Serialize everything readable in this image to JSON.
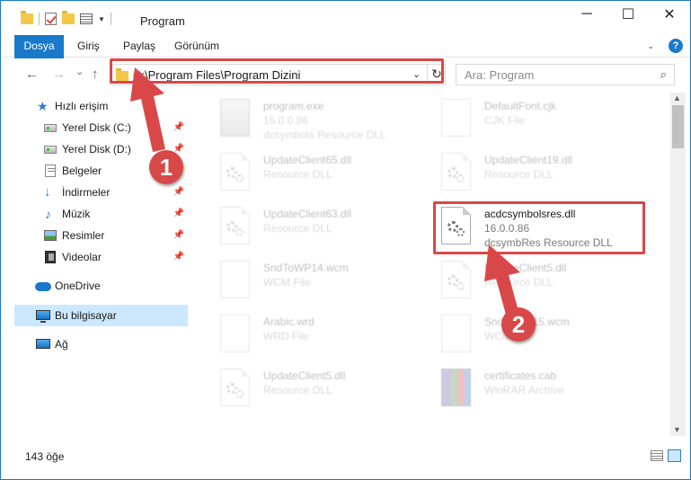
{
  "window": {
    "title": "Program",
    "controls": {
      "minimize": "─",
      "maximize": "☐",
      "close": "✕"
    }
  },
  "ribbon": {
    "tabs": [
      "Dosya",
      "Giriş",
      "Paylaş",
      "Görünüm"
    ],
    "help": "?"
  },
  "nav": {
    "back": "←",
    "forward": "→",
    "recent": "⌄",
    "up": "↑",
    "address": "C:\\Program Files\\Program Dizini",
    "search_placeholder": "Ara: Program"
  },
  "sidebar": {
    "items": [
      {
        "label": "Hızlı erişim",
        "icon": "star-icon",
        "pinned": false
      },
      {
        "label": "Yerel Disk (C:)",
        "icon": "disk-icon",
        "pinned": true
      },
      {
        "label": "Yerel Disk (D:)",
        "icon": "disk-icon",
        "pinned": true
      },
      {
        "label": "Belgeler",
        "icon": "document-icon",
        "pinned": true
      },
      {
        "label": "İndirmeler",
        "icon": "download-icon",
        "pinned": true
      },
      {
        "label": "Müzik",
        "icon": "music-icon",
        "pinned": true
      },
      {
        "label": "Resimler",
        "icon": "pictures-icon",
        "pinned": true
      },
      {
        "label": "Videolar",
        "icon": "videos-icon",
        "pinned": true
      },
      {
        "label": "OneDrive",
        "icon": "cloud-icon",
        "pinned": false
      },
      {
        "label": "Bu bilgisayar",
        "icon": "computer-icon",
        "pinned": false,
        "selected": true
      },
      {
        "label": "Ağ",
        "icon": "network-icon",
        "pinned": false
      }
    ]
  },
  "files": [
    {
      "name": "program.exe",
      "line2": "16.0.0.86",
      "line3": "dcsymbols Resource DLL",
      "icon": "exe-icon",
      "faded": true
    },
    {
      "name": "DefaultFont.cjk",
      "line2": "CJK File",
      "line3": "",
      "icon": "blank-file-icon",
      "faded": true
    },
    {
      "name": "UpdateClient65.dll",
      "line2": "Resource DLL",
      "line3": "",
      "icon": "dll-icon",
      "faded": true
    },
    {
      "name": "UpdateClient19.dll",
      "line2": "Resource DLL",
      "line3": "",
      "icon": "dll-icon",
      "faded": true
    },
    {
      "name": "UpdateClient63.dll",
      "line2": "Resource DLL",
      "line3": "",
      "icon": "dll-icon",
      "faded": true
    },
    {
      "name": "acdcsymbolsres.dll",
      "line2": "16.0.0.86",
      "line3": "dcsymbRes Resource DLL",
      "icon": "dll-icon",
      "faded": false
    },
    {
      "name": "SndToWP14.wcm",
      "line2": "WCM File",
      "line3": "",
      "icon": "blank-file-icon",
      "faded": true
    },
    {
      "name": "UpdateClient5.dll",
      "line2": "Resource DLL",
      "line3": "",
      "icon": "dll-icon",
      "faded": true
    },
    {
      "name": "Arabic.wrd",
      "line2": "WRD File",
      "line3": "",
      "icon": "blank-file-icon",
      "faded": true
    },
    {
      "name": "SndToWP15.wcm",
      "line2": "WCM File",
      "line3": "",
      "icon": "blank-file-icon",
      "faded": true
    },
    {
      "name": "UpdateClient5.dll",
      "line2": "Resource DLL",
      "line3": "",
      "icon": "dll-icon",
      "faded": true
    },
    {
      "name": "certificates.cab",
      "line2": "WinRAR Archive",
      "line3": "",
      "icon": "archive-icon",
      "faded": true
    }
  ],
  "annotations": {
    "step1": "1",
    "step2": "2"
  },
  "status": {
    "count": "143 öğe"
  },
  "colors": {
    "accent": "#1979ca",
    "highlight": "#d94848",
    "selected": "#cce8ff"
  }
}
